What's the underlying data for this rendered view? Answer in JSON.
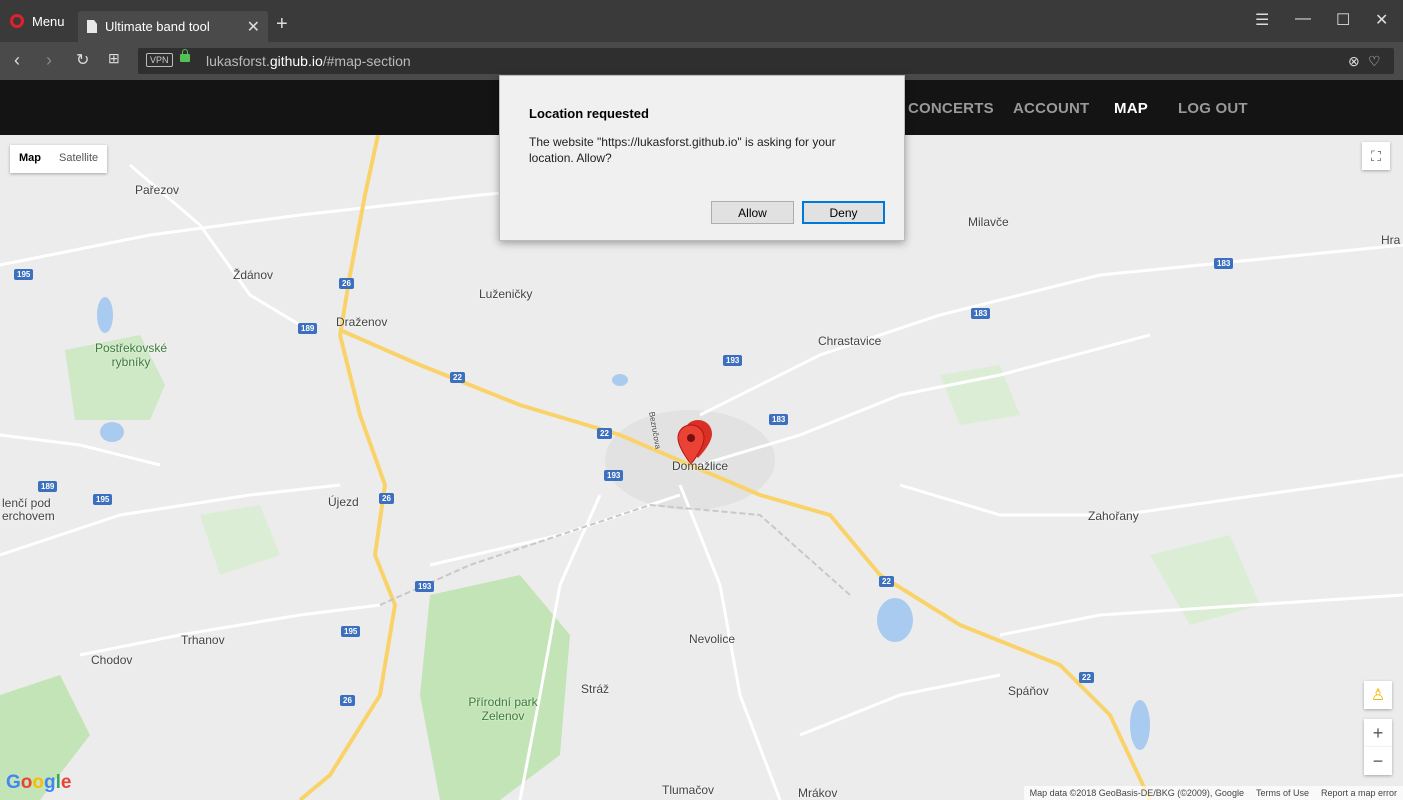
{
  "browser": {
    "menu_label": "Menu",
    "tab_title": "Ultimate band tool",
    "vpn_label": "VPN",
    "url_prefix": "lukasforst.",
    "url_domain": "github.io",
    "url_path": "/#map-section"
  },
  "site_nav": {
    "items": [
      {
        "label": "CONCERTS",
        "active": false
      },
      {
        "label": "ACCOUNT",
        "active": false
      },
      {
        "label": "MAP",
        "active": true
      },
      {
        "label": "LOG OUT",
        "active": false
      }
    ]
  },
  "map": {
    "type_buttons": {
      "map": "Map",
      "satellite": "Satellite"
    },
    "towns": [
      "Pařezov",
      "Ždánov",
      "Draženov",
      "Luženičky",
      "Milavče",
      "Chrastavice",
      "Domažlice",
      "Postřekovské rybníky",
      "Újezd",
      "Zahořany",
      "Nevolice",
      "Trhanov",
      "Chodov",
      "Stráž",
      "Přírodní park Zelenov",
      "Spáňov",
      "Tlumačov",
      "Mrákov",
      "Hra",
      "lenčí pod",
      "erchovem",
      "Bezručova"
    ],
    "road_numbers": [
      "195",
      "26",
      "189",
      "22",
      "193",
      "183"
    ],
    "zoom_in": "+",
    "zoom_out": "−",
    "google_logo": "Google",
    "attribution": {
      "data": "Map data ©2018 GeoBasis-DE/BKG (©2009), Google",
      "terms": "Terms of Use",
      "report": "Report a map error"
    }
  },
  "dialog": {
    "title": "Location requested",
    "message": "The website \"https://lukasforst.github.io\" is asking for your location. Allow?",
    "allow_label": "Allow",
    "deny_label": "Deny"
  },
  "colors": {
    "accent": "#0078d7",
    "marker": "#d93025",
    "road_shield": "#3d6fbf"
  }
}
